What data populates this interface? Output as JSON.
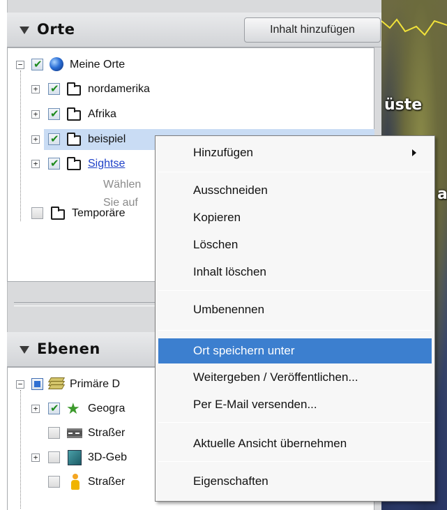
{
  "orte_panel": {
    "title": "Orte",
    "add_button": "Inhalt hinzufügen",
    "items": [
      {
        "label": "Meine Orte"
      },
      {
        "label": "nordamerika"
      },
      {
        "label": "Afrika"
      },
      {
        "label": "beispiel"
      },
      {
        "label": "Sightse"
      },
      {
        "label": "Wählen"
      },
      {
        "label": "Sie auf"
      },
      {
        "label": "Temporäre"
      }
    ]
  },
  "ebenen_panel": {
    "title": "Ebenen",
    "items": [
      {
        "label": "Primäre D"
      },
      {
        "label": "Geogra"
      },
      {
        "label": "Straßer"
      },
      {
        "label": "3D-Geb"
      },
      {
        "label": "Straßer"
      }
    ]
  },
  "map": {
    "label_top": "üste",
    "label_mid": "a"
  },
  "context_menu": {
    "items": [
      {
        "label": "Hinzufügen",
        "submenu": true
      },
      {
        "label": "Ausschneiden"
      },
      {
        "label": "Kopieren"
      },
      {
        "label": "Löschen"
      },
      {
        "label": "Inhalt löschen"
      },
      {
        "label": "Umbenennen"
      },
      {
        "label": "Ort speichern unter",
        "highlighted": true
      },
      {
        "label": "Weitergeben / Veröffentlichen..."
      },
      {
        "label": "Per E-Mail versenden..."
      },
      {
        "label": "Aktuelle Ansicht übernehmen"
      },
      {
        "label": "Eigenschaften"
      }
    ]
  },
  "colors": {
    "highlight": "#3c7fcf",
    "selection": "#c9dcf4",
    "link": "#1d3fc7"
  }
}
